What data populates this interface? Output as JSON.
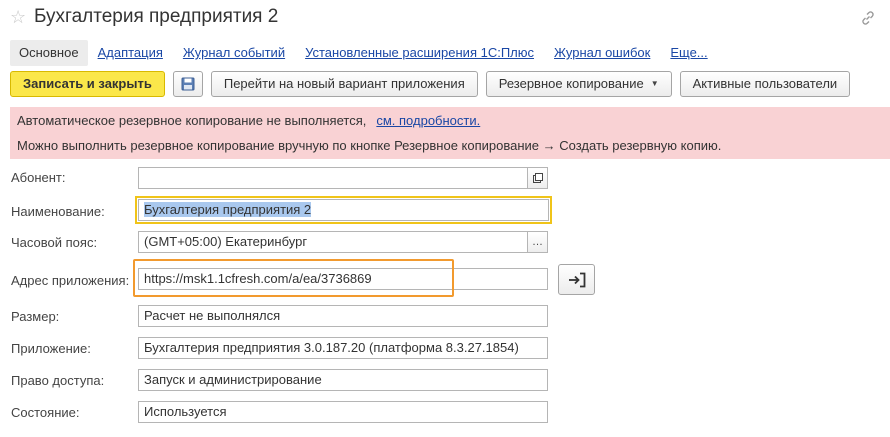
{
  "window": {
    "title": "Бухгалтерия предприятия 2",
    "favorite_icon": "star-icon",
    "link_icon": "link-icon"
  },
  "tabs": [
    {
      "label": "Основное",
      "active": true
    },
    {
      "label": "Адаптация"
    },
    {
      "label": "Журнал событий"
    },
    {
      "label": "Установленные расширения 1С:Плюс"
    },
    {
      "label": "Журнал ошибок"
    },
    {
      "label": "Еще..."
    }
  ],
  "toolbar": {
    "save_close_label": "Записать и закрыть",
    "save_icon": "floppy-disk-icon",
    "new_version_label": "Перейти на новый вариант приложения",
    "backup_label": "Резервное копирование",
    "active_users_label": "Активные пользователи"
  },
  "warning": {
    "line1": "Автоматическое резервное копирование не выполняется,",
    "line1_link": "см. подробности.",
    "line2": "Можно выполнить резервное копирование вручную по кнопке Резервное копирование → Создать резервную копию.",
    "background": "#f9d2d4"
  },
  "form": {
    "subscriber": {
      "label": "Абонент:",
      "value": ""
    },
    "name": {
      "label": "Наименование:",
      "value": "Бухгалтерия предприятия 2"
    },
    "timezone": {
      "label": "Часовой пояс:",
      "value": "(GMT+05:00) Екатеринбург"
    },
    "app_address": {
      "label": "Адрес приложения:",
      "value": "https://msk1.1cfresh.com/a/ea/3736869"
    },
    "size": {
      "label": "Размер:",
      "value": "Расчет не выполнялся"
    },
    "application": {
      "label": "Приложение:",
      "value": "Бухгалтерия предприятия 3.0.187.20 (платформа 8.3.27.1854)"
    },
    "access": {
      "label": "Право доступа:",
      "value": "Запуск и администрирование"
    },
    "state": {
      "label": "Состояние:",
      "value": "Используется"
    }
  },
  "colors": {
    "primary_button": "#fbe74a",
    "link": "#1a47a5",
    "highlight_orange": "#f29a2e",
    "focus_yellow": "#f0c419"
  }
}
